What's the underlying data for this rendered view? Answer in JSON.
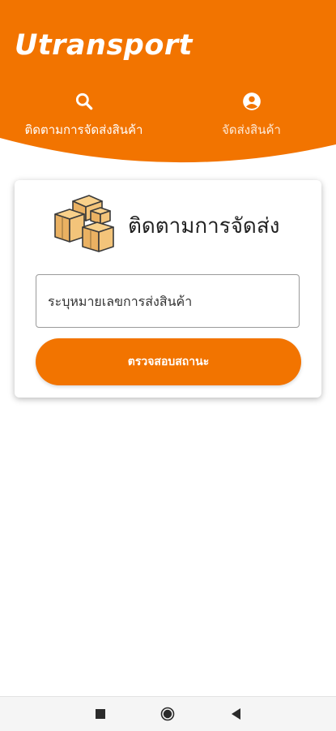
{
  "app": {
    "title": "Utransport"
  },
  "tabs": [
    {
      "label": "ติดตามการจัดส่งสินค้า",
      "icon": "search-icon"
    },
    {
      "label": "จัดส่งสินค้า",
      "icon": "account-circle-icon"
    }
  ],
  "card": {
    "title": "ติดตามการจัดส่ง",
    "input_placeholder": "ระบุหมายเลขการส่งสินค้า",
    "input_value": "",
    "button_label": "ตรวจสอบสถานะ",
    "illustration": "boxes-icon"
  },
  "navbar": {
    "icons": [
      "recents-square-icon",
      "home-circle-icon",
      "back-triangle-icon"
    ]
  },
  "colors": {
    "accent": "#f27400",
    "surface": "#ffffff",
    "text": "#222222"
  }
}
